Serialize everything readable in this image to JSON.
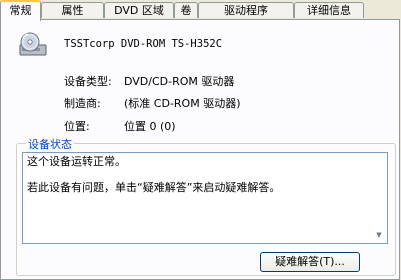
{
  "tabs": [
    {
      "label": "常规",
      "active": true
    },
    {
      "label": "属性",
      "active": false
    },
    {
      "label": "DVD 区域",
      "active": false
    },
    {
      "label": "卷",
      "active": false
    },
    {
      "label": "驱动程序",
      "active": false
    },
    {
      "label": "详细信息",
      "active": false
    }
  ],
  "device": {
    "icon": "cd-drive-icon",
    "name": "TSSTcorp DVD-ROM TS-H352C"
  },
  "properties": {
    "device_type_label": "设备类型:",
    "device_type_value": "DVD/CD-ROM 驱动器",
    "manufacturer_label": "制造商:",
    "manufacturer_value": "(标准 CD-ROM 驱动器)",
    "location_label": "位置:",
    "location_value": "位置 0 (0)"
  },
  "status": {
    "group_title": "设备状态",
    "line1": "这个设备运转正常。",
    "line2": "若此设备有问题，单击“疑难解答”来启动疑难解答。"
  },
  "buttons": {
    "troubleshoot": "疑难解答(T)..."
  },
  "colors": {
    "window_bg": "#ECE9D8",
    "panel_bg": "#FCFCFE",
    "active_tab_accent": "#FFC83C",
    "group_title": "#0046D5"
  }
}
